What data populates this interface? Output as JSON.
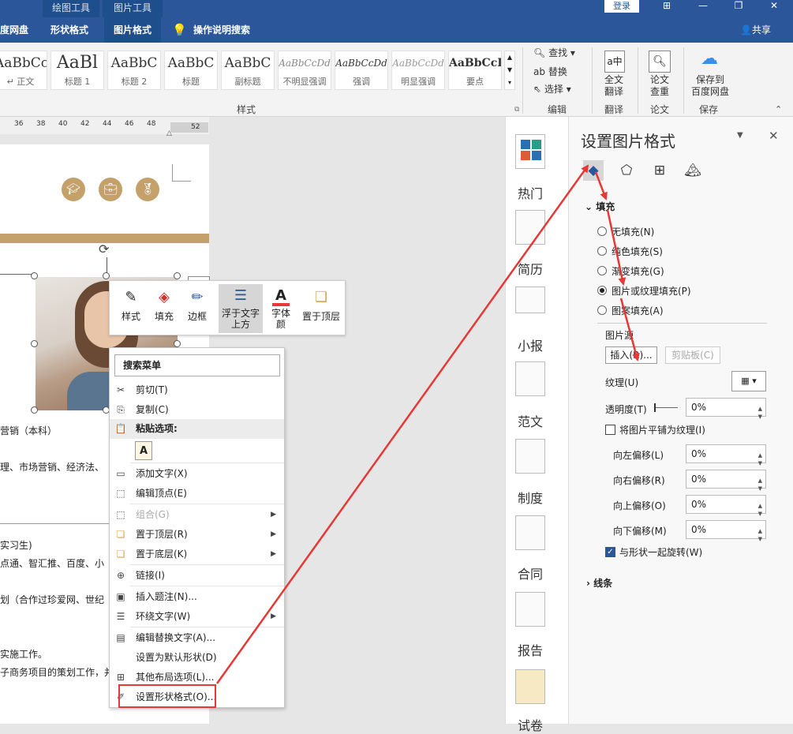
{
  "title_bar": {
    "context_tabs": [
      "绘图工具",
      "图片工具"
    ],
    "login": "登录",
    "window_buttons": [
      "⊞",
      "—",
      "❐",
      "✕"
    ]
  },
  "tabs": [
    "度网盘",
    "形状格式",
    "图片格式"
  ],
  "tell_me": "操作说明搜索",
  "share": "共享",
  "ribbon": {
    "styles": [
      {
        "sample": "AaBbCcD",
        "name": "↵ 正文"
      },
      {
        "sample": "AaBl",
        "name": "标题 1"
      },
      {
        "sample": "AaBbC",
        "name": "标题 2"
      },
      {
        "sample": "AaBbC",
        "name": "标题"
      },
      {
        "sample": "AaBbC",
        "name": "副标题"
      },
      {
        "sample": "AaBbCcDd",
        "name": "不明显强调"
      },
      {
        "sample": "AaBbCcDd",
        "name": "强调"
      },
      {
        "sample": "AaBbCcDd",
        "name": "明显强调"
      },
      {
        "sample": "AaBbCcD",
        "name": "要点"
      }
    ],
    "styles_group": "样式",
    "edit_find": "查找",
    "edit_replace": "替换",
    "edit_select": "选择",
    "edit_group": "编辑",
    "translate_line1": "全文",
    "translate_line2": "翻译",
    "translate_group": "翻译",
    "paper_line1": "论文",
    "paper_line2": "查重",
    "paper_group": "论文",
    "save_line1": "保存到",
    "save_line2": "百度网盘",
    "save_group": "保存"
  },
  "ruler": [
    "36",
    "38",
    "40",
    "42",
    "44",
    "46",
    "48",
    "52"
  ],
  "doc": {
    "icons": [
      "graduation-cap-icon",
      "briefcase-icon",
      "medal-icon"
    ],
    "lines": [
      "营销（本科）",
      "理、市场营销、经济法、",
      "实习生)",
      "点通、智汇推、百度、小",
      "划（合作过珍爱网、世纪",
      "实施工作。",
      "子商务项目的策划工作，并"
    ]
  },
  "mini_toolbar": [
    {
      "label": "样式",
      "icon": "✎"
    },
    {
      "label": "填充",
      "icon": "◈"
    },
    {
      "label": "边框",
      "icon": "✏"
    },
    {
      "label": "浮于文字上方",
      "icon": "☰"
    },
    {
      "label": "字体颜",
      "icon": "A"
    },
    {
      "label": "置于顶层",
      "icon": "❏"
    }
  ],
  "menu": {
    "search": "搜索菜单",
    "items": [
      {
        "label": "剪切(T)",
        "icon": "✂"
      },
      {
        "label": "复制(C)",
        "icon": "⎘"
      },
      {
        "label": "粘贴选项:",
        "icon": "📋"
      },
      {
        "label": "添加文字(X)",
        "icon": "▭"
      },
      {
        "label": "编辑顶点(E)",
        "icon": "⬚"
      },
      {
        "label": "组合(G)",
        "icon": "⬚"
      },
      {
        "label": "置于顶层(R)",
        "icon": "❏"
      },
      {
        "label": "置于底层(K)",
        "icon": "❏"
      },
      {
        "label": "链接(I)",
        "icon": "⊕"
      },
      {
        "label": "插入题注(N)...",
        "icon": "▣"
      },
      {
        "label": "环绕文字(W)",
        "icon": "☰"
      },
      {
        "label": "编辑替换文字(A)...",
        "icon": "▤"
      },
      {
        "label": "设置为默认形状(D)",
        "icon": ""
      },
      {
        "label": "其他布局选项(L)...",
        "icon": "⊞"
      },
      {
        "label": "设置形状格式(O)...",
        "icon": "✐"
      }
    ]
  },
  "side_strip": [
    "热门",
    "简历",
    "小报",
    "范文",
    "制度",
    "合同",
    "报告",
    "试卷"
  ],
  "pane": {
    "title": "设置图片格式",
    "tab_icons": [
      "fill-line-icon",
      "effects-icon",
      "layout-icon",
      "picture-icon"
    ],
    "fill_header": "填充",
    "options": [
      "无填充(N)",
      "纯色填充(S)",
      "渐变填充(G)",
      "图片或纹理填充(P)",
      "图案填充(A)"
    ],
    "selected_option": "图片或纹理填充(P)",
    "source_label": "图片源",
    "insert_button": "插入(R)...",
    "clipboard_button": "剪贴板(C)",
    "texture_label": "纹理(U)",
    "transparency_label": "透明度(T)",
    "transparency_value": "0%",
    "tile_label": "将图片平铺为纹理(I)",
    "offsets": [
      {
        "label": "向左偏移(L)",
        "value": "0%"
      },
      {
        "label": "向右偏移(R)",
        "value": "0%"
      },
      {
        "label": "向上偏移(O)",
        "value": "0%"
      },
      {
        "label": "向下偏移(M)",
        "value": "0%"
      }
    ],
    "rotate_label": "与形状一起旋转(W)",
    "line_header": "线条"
  },
  "colors": {
    "accent": "#2b579a",
    "gold": "#c4a06a",
    "annotation": "#e53935"
  }
}
